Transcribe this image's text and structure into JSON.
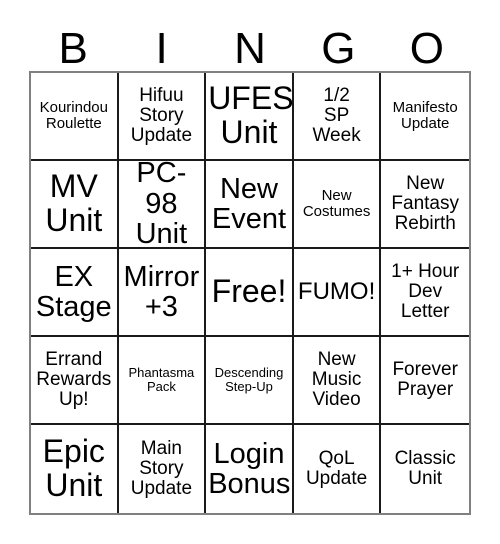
{
  "card": {
    "title_letters": [
      "B",
      "I",
      "N",
      "G",
      "O"
    ],
    "colors": {
      "background": "#ffffff",
      "text": "#000000",
      "inner_grid_line": "#1a1a1a",
      "outer_border": "#808080"
    },
    "grid_size": "5x5",
    "free_space_label": "Free!",
    "cells": [
      {
        "text": "Kourindou\nRoulette",
        "size": "fs-sm"
      },
      {
        "text": "Hifuu\nStory\nUpdate",
        "size": "fs-md"
      },
      {
        "text": "UFES\nUnit",
        "size": "fs-xxl"
      },
      {
        "text": "1/2\nSP\nWeek",
        "size": "fs-md"
      },
      {
        "text": "Manifesto\nUpdate",
        "size": "fs-sm"
      },
      {
        "text": "MV\nUnit",
        "size": "fs-xxl"
      },
      {
        "text": "PC-98\nUnit",
        "size": "fs-xl"
      },
      {
        "text": "New\nEvent",
        "size": "fs-xl"
      },
      {
        "text": "New\nCostumes",
        "size": "fs-sm"
      },
      {
        "text": "New\nFantasy\nRebirth",
        "size": "fs-md"
      },
      {
        "text": "EX\nStage",
        "size": "fs-xl"
      },
      {
        "text": "Mirror\n+3",
        "size": "fs-xl"
      },
      {
        "text": "Free!",
        "size": "fs-xxl"
      },
      {
        "text": "FUMO!",
        "size": "fs-lg"
      },
      {
        "text": "1+ Hour\nDev\nLetter",
        "size": "fs-md"
      },
      {
        "text": "Errand\nRewards\nUp!",
        "size": "fs-md"
      },
      {
        "text": "Phantasma\nPack",
        "size": "fs-xs"
      },
      {
        "text": "Descending\nStep-Up",
        "size": "fs-xs"
      },
      {
        "text": "New\nMusic\nVideo",
        "size": "fs-md"
      },
      {
        "text": "Forever\nPrayer",
        "size": "fs-md"
      },
      {
        "text": "Epic\nUnit",
        "size": "fs-xxl"
      },
      {
        "text": "Main\nStory\nUpdate",
        "size": "fs-md"
      },
      {
        "text": "Login\nBonus",
        "size": "fs-xl"
      },
      {
        "text": "QoL\nUpdate",
        "size": "fs-md"
      },
      {
        "text": "Classic\nUnit",
        "size": "fs-md"
      }
    ]
  }
}
